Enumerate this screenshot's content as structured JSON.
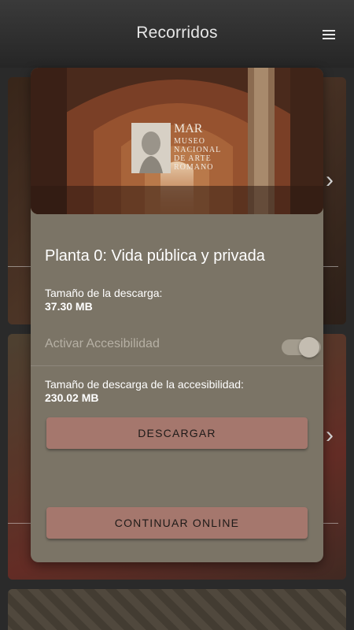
{
  "header": {
    "title": "Recorridos",
    "menu_icon": "hamburger-menu-icon"
  },
  "background_cards": [
    {
      "chevron": "›"
    },
    {
      "chevron": "›"
    },
    {}
  ],
  "modal": {
    "hero": {
      "logo_mark": "MAR",
      "logo_lines": [
        "MUSEO",
        "NACIONAL",
        "DE ARTE",
        "ROMANO"
      ]
    },
    "title": "Planta 0: Vida pública y privada",
    "download_size_label": "Tamaño de la descarga:",
    "download_size_value": "37.30 MB",
    "accessibility_label": "Activar Accesibilidad",
    "accessibility_enabled": false,
    "accessibility_size_label": "Tamaño de descarga de la accesibilidad:",
    "accessibility_size_value": "230.02 MB",
    "download_button": "Descargar",
    "online_button": "Continuar online"
  },
  "colors": {
    "modal_bg": "#7b7466",
    "button_bg": "#a5776d",
    "header_text": "#e6e6e6"
  }
}
